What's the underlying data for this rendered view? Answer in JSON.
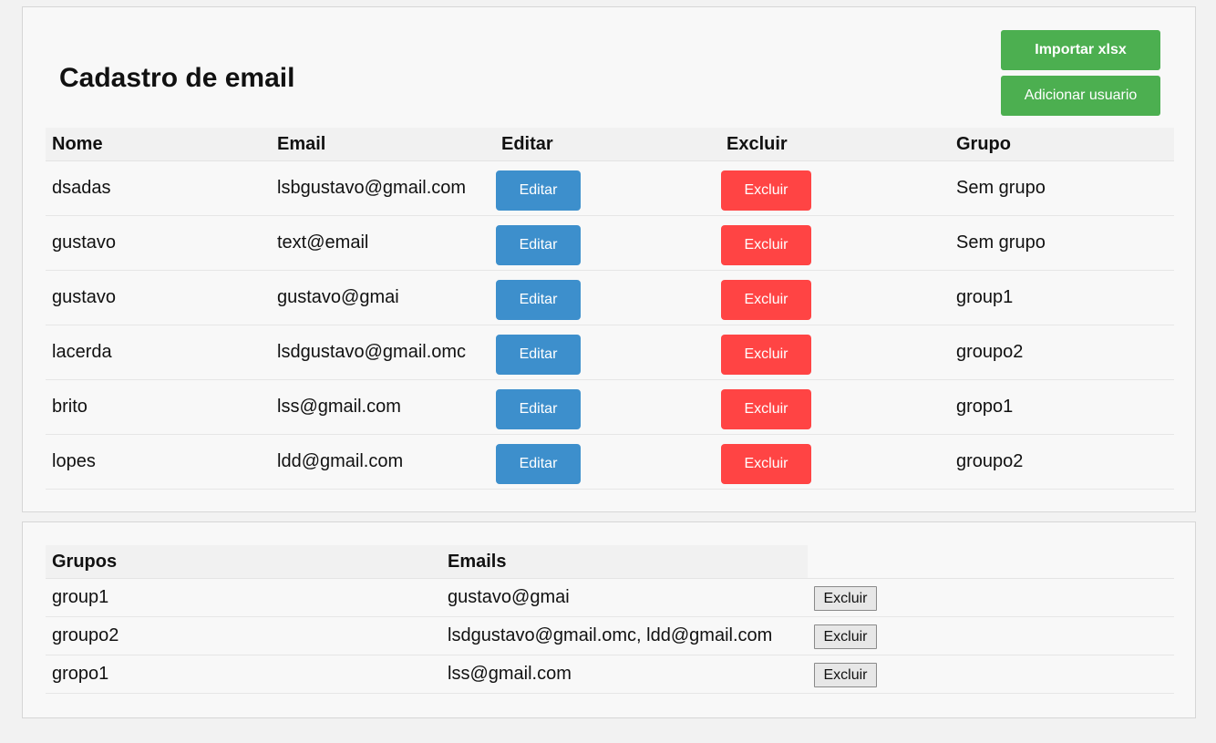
{
  "header": {
    "title": "Cadastro de email",
    "import_label": "Importar xlsx",
    "add_label": "Adicionar usuario"
  },
  "users_table": {
    "columns": [
      "Nome",
      "Email",
      "Editar",
      "Excluir",
      "Grupo"
    ],
    "edit_label": "Editar",
    "delete_label": "Excluir",
    "rows": [
      {
        "name": "dsadas",
        "email": "lsbgustavo@gmail.com",
        "group": "Sem grupo"
      },
      {
        "name": "gustavo",
        "email": "text@email",
        "group": "Sem grupo"
      },
      {
        "name": "gustavo",
        "email": "gustavo@gmai",
        "group": "group1"
      },
      {
        "name": "lacerda",
        "email": "lsdgustavo@gmail.omc",
        "group": "groupo2"
      },
      {
        "name": "brito",
        "email": "lss@gmail.com",
        "group": "gropo1"
      },
      {
        "name": "lopes",
        "email": "ldd@gmail.com",
        "group": "groupo2"
      }
    ]
  },
  "groups_table": {
    "columns": [
      "Grupos",
      "Emails"
    ],
    "delete_label": "Excluir",
    "rows": [
      {
        "group": "group1",
        "emails": "gustavo@gmai"
      },
      {
        "group": "groupo2",
        "emails": "lsdgustavo@gmail.omc, ldd@gmail.com"
      },
      {
        "group": "gropo1",
        "emails": "lss@gmail.com"
      }
    ]
  },
  "colors": {
    "green": "#4caf50",
    "blue": "#3d8fcc",
    "red": "#ff4444"
  }
}
